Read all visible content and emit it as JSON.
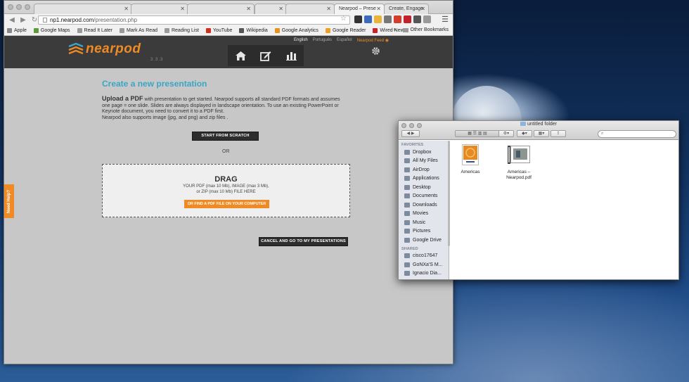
{
  "browser": {
    "tabs": [
      {
        "label": ""
      },
      {
        "label": ""
      },
      {
        "label": ""
      },
      {
        "label": ""
      },
      {
        "label": ""
      },
      {
        "label": "Nearpod – Prese"
      },
      {
        "label": "Create, Engage"
      }
    ],
    "url_host": "np1.nearpod.com",
    "url_path": "/presentation.php",
    "bookmarks": [
      {
        "label": "Apple",
        "color": "#888888"
      },
      {
        "label": "Google Maps",
        "color": "#5f9a3c"
      },
      {
        "label": "Read It Later",
        "color": "#9a9a9a"
      },
      {
        "label": "Mark As Read",
        "color": "#9a9a9a"
      },
      {
        "label": "Reading List",
        "color": "#9a9a9a"
      },
      {
        "label": "YouTube",
        "color": "#d42e20"
      },
      {
        "label": "Wikipedia",
        "color": "#555555"
      },
      {
        "label": "Google Analytics",
        "color": "#e8911c"
      },
      {
        "label": "Google Reader",
        "color": "#f0a024"
      },
      {
        "label": "Wired News",
        "color": "#c8222a"
      }
    ],
    "other_bookmarks": "Other Bookmarks",
    "chevron": "»"
  },
  "nearpod": {
    "logo_text": "nearpod",
    "version": "3.3.3",
    "languages": [
      "English",
      "Português",
      "Español"
    ],
    "feed_label": "Nearpod Feed",
    "nav_icons": [
      "home-icon",
      "edit-icon",
      "reports-icon"
    ],
    "accent_color": "#f08a24",
    "title_color": "#3aa6c7"
  },
  "main": {
    "title": "Create a new presentation",
    "upload_heading": "Upload a PDF",
    "upload_text": " with presentation to get started. Nearpod supports all standard PDF formats and assumes one page = one slide. Slides are always displayed in landscape orientation. To use an existing PowerPoint or Keynote document, you need to convert it to a PDF first.",
    "upload_text2": "Nearpod also supports image (jpg, and png) and zip files .",
    "start_button": "START FROM SCRATCH",
    "or": "OR",
    "drag_title": "DRAG",
    "drag_line1": "YOUR PDF (max 10 Mb), IMAGE (max 3 Mb),",
    "drag_line2": "or ZIP (max 10 Mb) FILE HERE",
    "find_button": "OR FIND A PDF FILE ON YOUR COMPUTER",
    "cancel_button": "CANCEL AND GO TO MY PRESENTATIONS",
    "need_help": "Need Help?"
  },
  "finder": {
    "title": "untitled folder",
    "favorites_label": "FAVORITES",
    "favorites": [
      "Dropbox",
      "All My Files",
      "AirDrop",
      "Applications",
      "Desktop",
      "Documents",
      "Downloads",
      "Movies",
      "Music",
      "Pictures",
      "Google Drive"
    ],
    "shared_label": "SHARED",
    "shared": [
      "cisco17647",
      "GoNXa'S M...",
      "Ignacio Dia..."
    ],
    "files": [
      {
        "name": "Americas",
        "name2": ""
      },
      {
        "name": "Americas –",
        "name2": "Nearpod.pdf"
      }
    ]
  }
}
